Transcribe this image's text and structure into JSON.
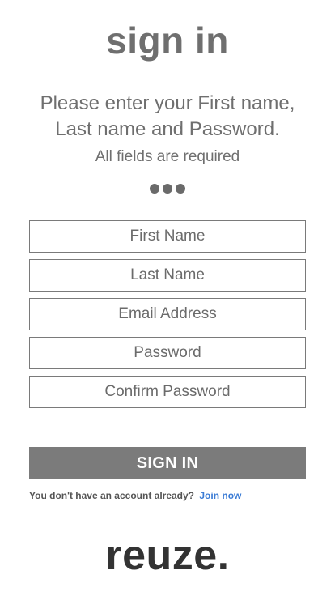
{
  "header": {
    "title": "sign in"
  },
  "instructions": {
    "line1": "Please enter your First name,",
    "line2": "Last name and Password.",
    "required_note": "All fields are required"
  },
  "form": {
    "first_name_placeholder": "First Name",
    "last_name_placeholder": "Last Name",
    "email_placeholder": "Email Address",
    "password_placeholder": "Password",
    "confirm_password_placeholder": "Confirm Password",
    "submit_label": "SIGN IN"
  },
  "footer": {
    "prompt_text": "You don't have an account already?",
    "join_link": "Join now"
  },
  "brand": {
    "logo_text": "reuze."
  },
  "colors": {
    "text_gray": "#6f6f6f",
    "button_gray": "#7b7b7b",
    "link_blue": "#3a7bd5",
    "logo_dark": "#333333"
  }
}
